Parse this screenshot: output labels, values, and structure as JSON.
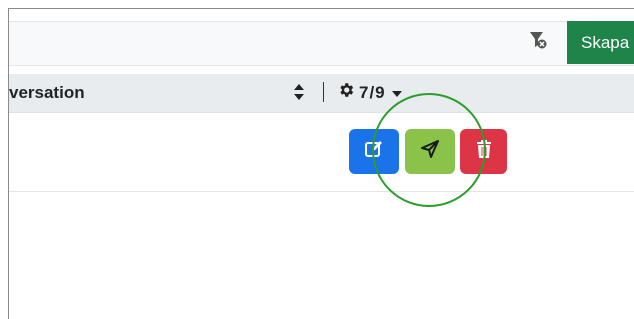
{
  "toolbar": {
    "filter_icon": "filter-clear-icon",
    "create_label": "Skapa"
  },
  "table": {
    "header": {
      "title": "versation",
      "sort_icon": "sort-icon",
      "columns_icon": "gear-icon",
      "columns_count": "7/9",
      "dropdown_icon": "caret-down-icon"
    },
    "row_actions": [
      {
        "name": "edit",
        "icon": "edit-icon",
        "color": "#1a73e8"
      },
      {
        "name": "send",
        "icon": "send-icon",
        "color": "#8bc34a"
      },
      {
        "name": "delete",
        "icon": "trash-icon",
        "color": "#dc3545"
      }
    ]
  },
  "colors": {
    "create_button": "#1e8449",
    "highlight_circle": "#2a9d2a"
  }
}
